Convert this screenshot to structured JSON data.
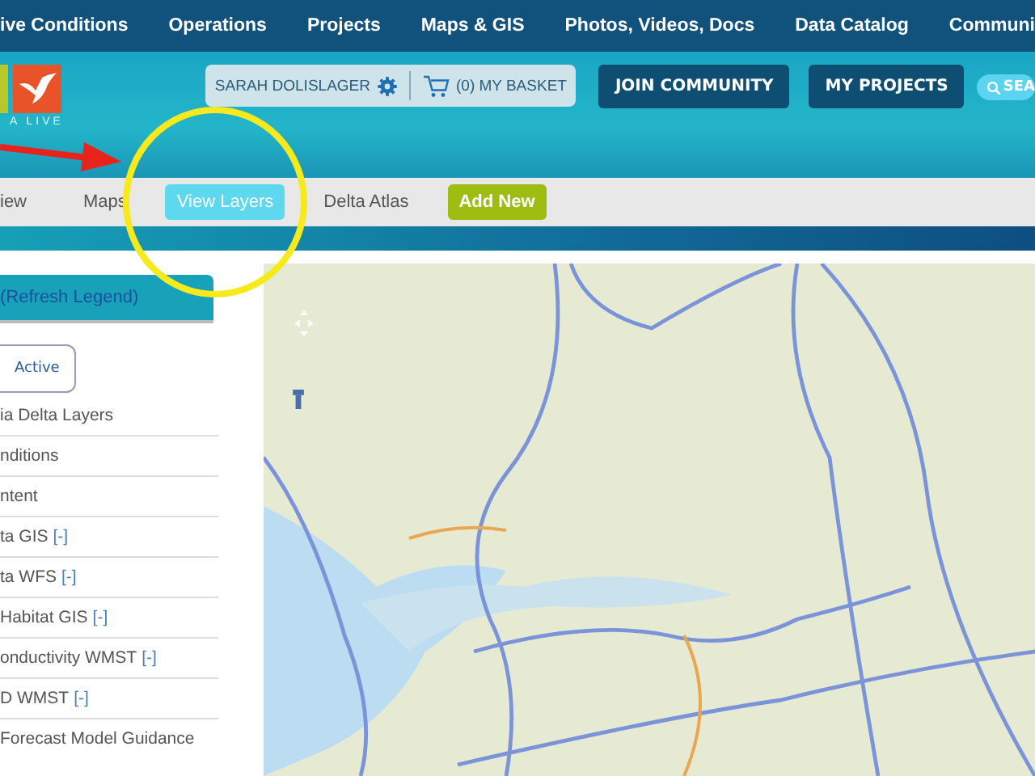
{
  "top_nav": [
    "ive Conditions",
    "Operations",
    "Projects",
    "Maps & GIS",
    "Photos, Videos, Docs",
    "Data Catalog",
    "Communi"
  ],
  "logo": {
    "tagline": "A LIVE"
  },
  "user": {
    "name": "SARAH DOLISLAGER",
    "basket": "(0) MY BASKET"
  },
  "header_buttons": [
    "JOIN COMMUNITY",
    "MY PROJECTS"
  ],
  "search": {
    "label": "SEA"
  },
  "sub_nav": [
    {
      "label": "iew",
      "kind": "link",
      "selected": false
    },
    {
      "label": "Maps",
      "kind": "link",
      "selected": false
    },
    {
      "label": "View Layers",
      "kind": "link",
      "selected": true
    },
    {
      "label": "Delta Atlas",
      "kind": "link",
      "selected": false
    },
    {
      "label": "Add New",
      "kind": "button",
      "selected": false
    }
  ],
  "sidebar": {
    "header": "(Refresh Legend)",
    "tabs": [
      {
        "label": "Active",
        "selected": true
      }
    ],
    "items": [
      {
        "label": "ia Delta Layers"
      },
      {
        "label": "nditions"
      },
      {
        "label": "ntent"
      },
      {
        "label": "ta GIS",
        "toggle": "[-]"
      },
      {
        "label": "ta WFS",
        "toggle": "[-]"
      },
      {
        "label": "Habitat GIS",
        "toggle": "[-]"
      },
      {
        "label": "onductivity WMST",
        "toggle": "[-]"
      },
      {
        "label": "D WMST",
        "toggle": "[-]"
      },
      {
        "label": "Forecast Model Guidance"
      }
    ]
  }
}
